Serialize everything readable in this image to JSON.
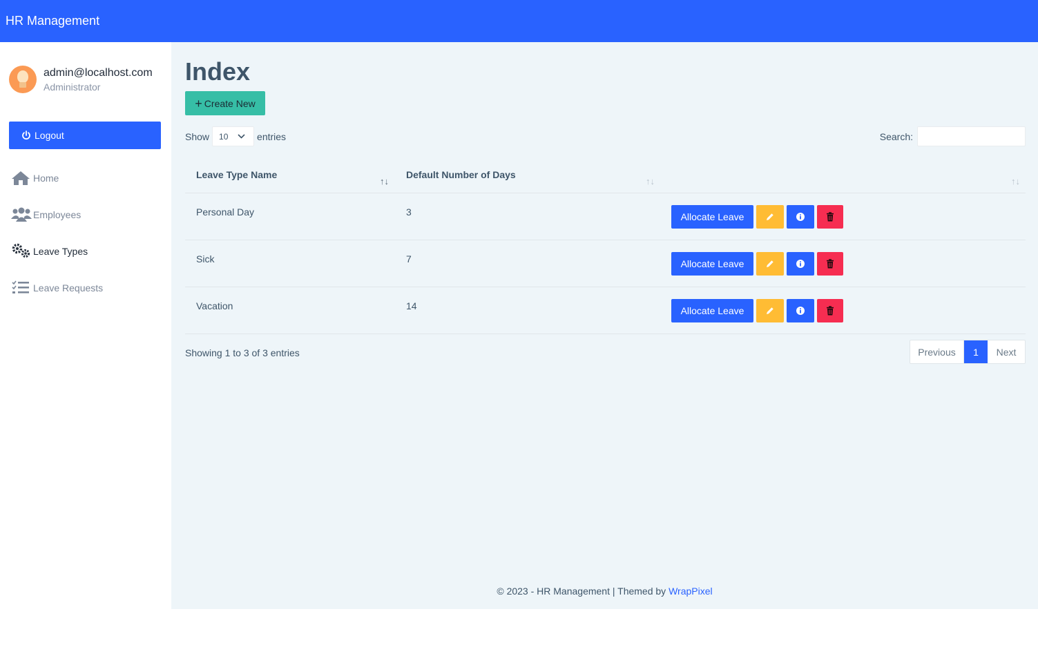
{
  "topbar": {
    "brand": "HR Management"
  },
  "sidebar": {
    "user": {
      "email": "admin@localhost.com",
      "role": "Administrator"
    },
    "logout_label": "Logout",
    "items": [
      {
        "label": "Home",
        "icon": "home-icon"
      },
      {
        "label": "Employees",
        "icon": "users-icon"
      },
      {
        "label": "Leave Types",
        "icon": "cogs-icon"
      },
      {
        "label": "Leave Requests",
        "icon": "tasks-icon"
      }
    ]
  },
  "main": {
    "title": "Index",
    "create_label": "Create New",
    "length": {
      "show": "Show",
      "value": "10",
      "entries": "entries"
    },
    "search_label": "Search:",
    "table": {
      "columns": [
        "Leave Type Name",
        "Default Number of Days",
        ""
      ],
      "rows": [
        {
          "name": "Personal Day",
          "days": "3"
        },
        {
          "name": "Sick",
          "days": "7"
        },
        {
          "name": "Vacation",
          "days": "14"
        }
      ],
      "allocate_label": "Allocate Leave"
    },
    "info": "Showing 1 to 3 of 3 entries",
    "pagination": {
      "previous": "Previous",
      "current": "1",
      "next": "Next"
    }
  },
  "footer": {
    "text": "© 2023 - HR Management | Themed by ",
    "link": "WrapPixel"
  },
  "colors": {
    "primary": "#2962ff",
    "success": "#36bea6",
    "warning": "#ffbc34",
    "danger": "#f62d51",
    "background": "#eef5f9"
  }
}
